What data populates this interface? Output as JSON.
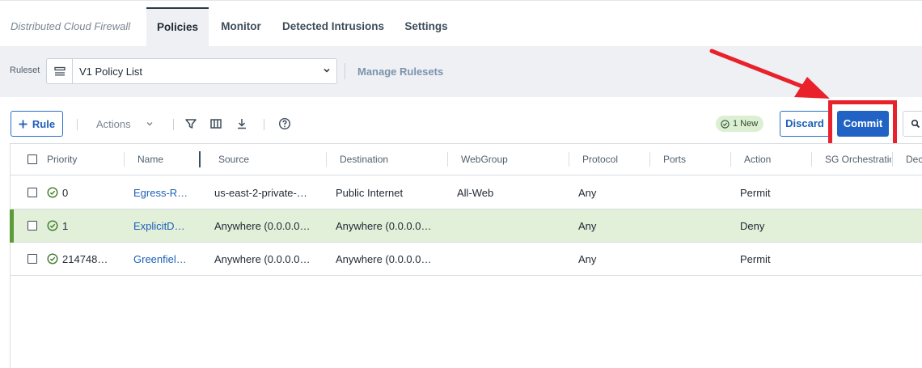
{
  "app": {
    "title": "Distributed Cloud Firewall"
  },
  "tabs": [
    {
      "label": "Policies",
      "active": true
    },
    {
      "label": "Monitor",
      "active": false
    },
    {
      "label": "Detected Intrusions",
      "active": false
    },
    {
      "label": "Settings",
      "active": false
    }
  ],
  "ruleset": {
    "label": "Ruleset",
    "selected": "V1 Policy List",
    "manage_link": "Manage Rulesets"
  },
  "toolbar": {
    "add_rule_label": "Rule",
    "actions_label": "Actions",
    "new_badge": "1 New",
    "discard_label": "Discard",
    "commit_label": "Commit"
  },
  "table": {
    "columns": [
      "Priority",
      "Name",
      "Source",
      "Destination",
      "WebGroup",
      "Protocol",
      "Ports",
      "Action",
      "SG Orchestration",
      "Decr"
    ],
    "rows": [
      {
        "priority": "0",
        "name": "Egress-R…",
        "source": "us-east-2-private-…",
        "destination": "Public Internet",
        "webgroup": "All-Web",
        "protocol": "Any",
        "ports": "",
        "action": "Permit",
        "selected": false
      },
      {
        "priority": "1",
        "name": "ExplicitD…",
        "source": "Anywhere (0.0.0.0…",
        "destination": "Anywhere (0.0.0.0…",
        "webgroup": "",
        "protocol": "Any",
        "ports": "",
        "action": "Deny",
        "selected": true
      },
      {
        "priority": "214748…",
        "name": "Greenfiel…",
        "source": "Anywhere (0.0.0.0…",
        "destination": "Anywhere (0.0.0.0…",
        "webgroup": "",
        "protocol": "Any",
        "ports": "",
        "action": "Permit",
        "selected": false
      }
    ]
  },
  "icons": {
    "status": "check-circle-icon",
    "filter": "filter-icon",
    "columns": "columns-icon",
    "download": "download-icon",
    "help": "help-icon",
    "search": "search-icon"
  },
  "colors": {
    "primary": "#2163c4",
    "selected_row": "#e2efd9",
    "selected_bar": "#5a9b3a",
    "annotation": "#e8212b"
  }
}
